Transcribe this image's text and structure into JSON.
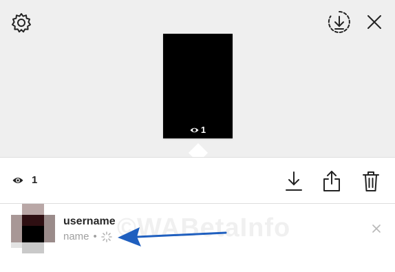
{
  "viewer": {
    "thumbnail_view_count": "1",
    "view_count": "1"
  },
  "viewer_row": {
    "username": "username",
    "name": "name",
    "separator": "•"
  },
  "watermark": "©WABetaInfo",
  "colors": {
    "top_background": "#efefef",
    "arrow": "#1f5fbf"
  },
  "icons": [
    "gear-icon",
    "download-circle-icon",
    "close-icon",
    "eye-icon",
    "download-icon",
    "share-icon",
    "trash-icon",
    "loading-spinner-icon"
  ]
}
